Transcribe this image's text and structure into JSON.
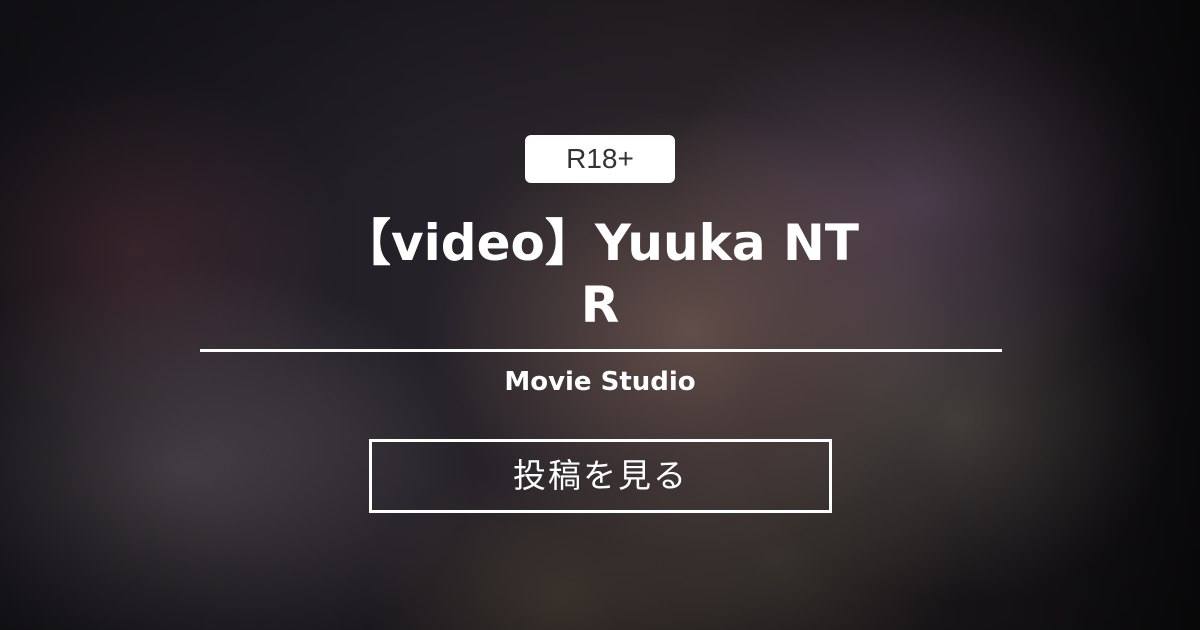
{
  "badge": {
    "label": "R18+"
  },
  "post": {
    "title": "【video】Yuuka NTR",
    "creator": "Movie Studio"
  },
  "cta": {
    "label": "投稿を見る"
  },
  "colors": {
    "text": "#ffffff",
    "badge_bg": "#ffffff",
    "badge_text": "#333333"
  }
}
